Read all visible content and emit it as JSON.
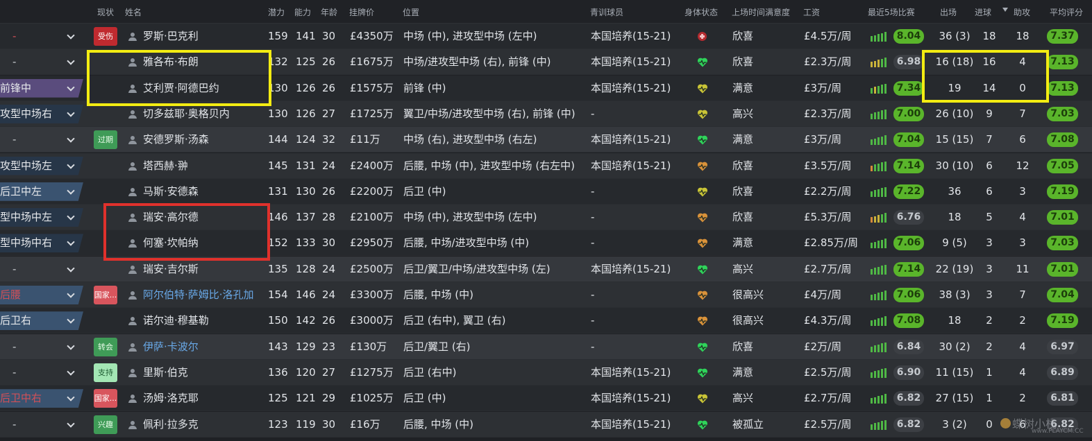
{
  "headers": {
    "status": "现状",
    "name": "姓名",
    "potential": "潜力",
    "ability": "能力",
    "age": "年龄",
    "price": "挂牌价",
    "position": "位置",
    "youth": "青训球员",
    "condition": "身体状态",
    "playtime": "上场时间满意度",
    "wage": "工资",
    "form": "最近5场比赛",
    "apps": "出场",
    "goals": "进球",
    "assists": "助攻",
    "avg": "平均评分"
  },
  "colors": {
    "heart_green": "#2fd35a",
    "heart_yellow": "#c9c437",
    "heart_orange": "#d9923a",
    "form_green": "#4fb845",
    "form_yellow": "#c9b33a",
    "form_orange": "#d68a3a",
    "highlight_yellow": "#f3ec12",
    "highlight_red": "#e0312c"
  },
  "players": [
    {
      "pos_role": "-",
      "pos_style": "plain",
      "pos_red": true,
      "badge": "受伤",
      "badge_style": "red",
      "name": "罗斯·巴克利",
      "link": false,
      "pot": "159",
      "abi": "141",
      "age": "30",
      "price": "£4350万",
      "position": "中场 (中), 进攻型中场 (左中)",
      "youth": "本国培养(15-21)",
      "cond": "injury-icon",
      "play": "欣喜",
      "wage": "£4.5万/周",
      "form": [
        "g",
        "g",
        "g",
        "g",
        "g"
      ],
      "r5": "8.04",
      "r5_style": "green",
      "apps": "36 (3)",
      "goals": "18",
      "assists": "18",
      "avg": "7.37",
      "avg_style": "green",
      "row": "even"
    },
    {
      "pos_role": "-",
      "pos_style": "plain",
      "pos_red": false,
      "badge": "",
      "badge_style": "",
      "name": "雅各布·布朗",
      "link": false,
      "pot": "132",
      "abi": "125",
      "age": "26",
      "price": "£1675万",
      "position": "中场/进攻型中场 (右), 前锋 (中)",
      "youth": "本国培养(15-21)",
      "cond": "heart-green-icon",
      "play": "欣喜",
      "wage": "£2.3万/周",
      "form": [
        "y",
        "y",
        "y",
        "g",
        "g"
      ],
      "r5": "6.98",
      "r5_style": "gray",
      "apps": "16 (18)",
      "goals": "16",
      "assists": "4",
      "avg": "7.13",
      "avg_style": "green",
      "row": "odd"
    },
    {
      "pos_role": "前锋中",
      "pos_style": "purple",
      "pos_red": false,
      "badge": "",
      "badge_style": "",
      "name": "艾利贾·阿德巴约",
      "link": false,
      "pot": "130",
      "abi": "126",
      "age": "26",
      "price": "£1575万",
      "position": "前锋 (中)",
      "youth": "本国培养(15-21)",
      "cond": "heart-yellow-icon",
      "play": "满意",
      "wage": "£3万/周",
      "form": [
        "g",
        "y",
        "g",
        "g",
        "g"
      ],
      "r5": "7.34",
      "r5_style": "green",
      "apps": "19",
      "goals": "14",
      "assists": "0",
      "avg": "7.13",
      "avg_style": "green",
      "row": "even"
    },
    {
      "pos_role": "攻型中场右",
      "pos_style": "navy",
      "pos_red": false,
      "badge": "",
      "badge_style": "",
      "name": "切多兹耶·奥格贝内",
      "link": false,
      "pot": "130",
      "abi": "126",
      "age": "27",
      "price": "£1725万",
      "position": "翼卫/中场/进攻型中场 (右), 前锋 (中)",
      "youth": "-",
      "cond": "heart-yellow-icon",
      "play": "高兴",
      "wage": "£2.3万/周",
      "form": [
        "g",
        "g",
        "g",
        "g",
        "g"
      ],
      "r5": "7.00",
      "r5_style": "green",
      "apps": "26 (10)",
      "goals": "9",
      "assists": "7",
      "avg": "7.03",
      "avg_style": "green",
      "row": "odd"
    },
    {
      "pos_role": "-",
      "pos_style": "plain",
      "pos_red": false,
      "badge": "过期",
      "badge_style": "green",
      "name": "安德罗斯·汤森",
      "link": false,
      "pot": "144",
      "abi": "124",
      "age": "32",
      "price": "£11万",
      "position": "中场 (右), 进攻型中场 (右左)",
      "youth": "本国培养(15-21)",
      "cond": "heart-green-icon",
      "play": "满意",
      "wage": "£3万/周",
      "form": [
        "g",
        "g",
        "g",
        "g",
        "g"
      ],
      "r5": "7.04",
      "r5_style": "green",
      "apps": "15 (15)",
      "goals": "7",
      "assists": "6",
      "avg": "7.08",
      "avg_style": "green",
      "row": "hl"
    },
    {
      "pos_role": "攻型中场左",
      "pos_style": "navy",
      "pos_red": false,
      "badge": "",
      "badge_style": "",
      "name": "塔西赫·翀",
      "link": false,
      "pot": "145",
      "abi": "131",
      "age": "24",
      "price": "£2400万",
      "position": "后腰, 中场 (中), 进攻型中场 (右左中)",
      "youth": "本国培养(15-21)",
      "cond": "heart-orange-icon",
      "play": "欣喜",
      "wage": "£3.5万/周",
      "form": [
        "o",
        "g",
        "g",
        "g",
        "g"
      ],
      "r5": "7.14",
      "r5_style": "green",
      "apps": "30 (10)",
      "goals": "6",
      "assists": "12",
      "avg": "7.05",
      "avg_style": "green",
      "row": "odd"
    },
    {
      "pos_role": "后卫中左",
      "pos_style": "steel",
      "pos_red": false,
      "badge": "",
      "badge_style": "",
      "name": "马斯·安德森",
      "link": false,
      "pot": "131",
      "abi": "130",
      "age": "26",
      "price": "£2200万",
      "position": "后卫 (中)",
      "youth": "-",
      "cond": "heart-yellow-icon",
      "play": "欣喜",
      "wage": "£2.2万/周",
      "form": [
        "g",
        "g",
        "g",
        "g",
        "g"
      ],
      "r5": "7.22",
      "r5_style": "green",
      "apps": "36",
      "goals": "6",
      "assists": "3",
      "avg": "7.19",
      "avg_style": "green",
      "row": "even"
    },
    {
      "pos_role": "型中场中左",
      "pos_style": "navy",
      "pos_red": false,
      "badge": "",
      "badge_style": "",
      "name": "瑞安·高尔德",
      "link": false,
      "pot": "146",
      "abi": "137",
      "age": "28",
      "price": "£2100万",
      "position": "中场 (中), 进攻型中场 (左中)",
      "youth": "-",
      "cond": "heart-orange-icon",
      "play": "欣喜",
      "wage": "£5.3万/周",
      "form": [
        "o",
        "y",
        "y",
        "g",
        "g"
      ],
      "r5": "6.76",
      "r5_style": "gray",
      "apps": "18",
      "goals": "5",
      "assists": "4",
      "avg": "7.01",
      "avg_style": "green",
      "row": "odd"
    },
    {
      "pos_role": "型中场中右",
      "pos_style": "navy",
      "pos_red": false,
      "badge": "",
      "badge_style": "",
      "name": "何塞·坎帕纳",
      "link": false,
      "pot": "152",
      "abi": "133",
      "age": "30",
      "price": "£2950万",
      "position": "后腰, 中场/进攻型中场 (中)",
      "youth": "-",
      "cond": "heart-orange-icon",
      "play": "满意",
      "wage": "£2.85万/周",
      "form": [
        "g",
        "g",
        "g",
        "g",
        "g"
      ],
      "r5": "7.06",
      "r5_style": "green",
      "apps": "9 (5)",
      "goals": "3",
      "assists": "3",
      "avg": "7.03",
      "avg_style": "green",
      "row": "even"
    },
    {
      "pos_role": "-",
      "pos_style": "plain",
      "pos_red": false,
      "badge": "",
      "badge_style": "",
      "name": "瑞安·吉尔斯",
      "link": false,
      "pot": "135",
      "abi": "128",
      "age": "24",
      "price": "£2500万",
      "position": "后卫/翼卫/中场/进攻型中场 (左)",
      "youth": "本国培养(15-21)",
      "cond": "heart-green-icon",
      "play": "高兴",
      "wage": "£2.7万/周",
      "form": [
        "g",
        "g",
        "g",
        "g",
        "g"
      ],
      "r5": "7.14",
      "r5_style": "green",
      "apps": "22 (19)",
      "goals": "3",
      "assists": "11",
      "avg": "7.01",
      "avg_style": "green",
      "row": "hl"
    },
    {
      "pos_role": "后腰",
      "pos_style": "steel",
      "pos_red": true,
      "badge": "国家...",
      "badge_style": "pink",
      "name": "阿尔伯特·萨姆比·洛孔加",
      "link": true,
      "pot": "154",
      "abi": "146",
      "age": "24",
      "price": "£3300万",
      "position": "后腰, 中场 (中)",
      "youth": "-",
      "cond": "heart-orange-icon",
      "play": "很高兴",
      "wage": "£4万/周",
      "form": [
        "g",
        "g",
        "g",
        "g",
        "g"
      ],
      "r5": "7.06",
      "r5_style": "green",
      "apps": "38 (3)",
      "goals": "3",
      "assists": "7",
      "avg": "7.04",
      "avg_style": "green",
      "row": "odd"
    },
    {
      "pos_role": "后卫右",
      "pos_style": "steel",
      "pos_red": false,
      "badge": "",
      "badge_style": "",
      "name": "诺尔迪·穆基勒",
      "link": false,
      "pot": "150",
      "abi": "142",
      "age": "26",
      "price": "£3000万",
      "position": "后卫 (右中), 翼卫 (右)",
      "youth": "-",
      "cond": "heart-orange-icon",
      "play": "很高兴",
      "wage": "£4.3万/周",
      "form": [
        "g",
        "g",
        "g",
        "g",
        "g"
      ],
      "r5": "7.08",
      "r5_style": "green",
      "apps": "18",
      "goals": "2",
      "assists": "2",
      "avg": "7.19",
      "avg_style": "green",
      "row": "even"
    },
    {
      "pos_role": "-",
      "pos_style": "plain",
      "pos_red": false,
      "badge": "转会",
      "badge_style": "green",
      "name": "伊萨·卡波尔",
      "link": true,
      "pot": "143",
      "abi": "129",
      "age": "23",
      "price": "£130万",
      "position": "后卫/翼卫 (右)",
      "youth": "-",
      "cond": "heart-green-icon",
      "play": "欣喜",
      "wage": "£2万/周",
      "form": [
        "g",
        "g",
        "g",
        "g",
        "g"
      ],
      "r5": "6.84",
      "r5_style": "gray",
      "apps": "30 (2)",
      "goals": "2",
      "assists": "4",
      "avg": "6.97",
      "avg_style": "gray",
      "row": "hl"
    },
    {
      "pos_role": "-",
      "pos_style": "plain",
      "pos_red": false,
      "badge": "支持",
      "badge_style": "mint",
      "name": "里斯·伯克",
      "link": false,
      "pot": "136",
      "abi": "120",
      "age": "27",
      "price": "£1275万",
      "position": "后卫 (右中)",
      "youth": "本国培养(15-21)",
      "cond": "heart-green-icon",
      "play": "满意",
      "wage": "£2.5万/周",
      "form": [
        "g",
        "g",
        "g",
        "g",
        "g"
      ],
      "r5": "6.90",
      "r5_style": "gray",
      "apps": "11 (15)",
      "goals": "1",
      "assists": "4",
      "avg": "6.89",
      "avg_style": "gray",
      "row": "odd"
    },
    {
      "pos_role": "后卫中右",
      "pos_style": "steel",
      "pos_red": true,
      "badge": "国家...",
      "badge_style": "pink",
      "name": "汤姆·洛克耶",
      "link": false,
      "pot": "125",
      "abi": "121",
      "age": "29",
      "price": "£1025万",
      "position": "后卫 (中)",
      "youth": "本国培养(15-21)",
      "cond": "heart-yellow-icon",
      "play": "高兴",
      "wage": "£2.7万/周",
      "form": [
        "g",
        "g",
        "g",
        "g",
        "g"
      ],
      "r5": "6.82",
      "r5_style": "gray",
      "apps": "27 (15)",
      "goals": "1",
      "assists": "2",
      "avg": "6.81",
      "avg_style": "gray",
      "row": "even"
    },
    {
      "pos_role": "-",
      "pos_style": "plain",
      "pos_red": false,
      "badge": "兴趣",
      "badge_style": "green",
      "name": "佩利·拉多克",
      "link": false,
      "pot": "123",
      "abi": "119",
      "age": "30",
      "price": "£16万",
      "position": "后腰, 中场 (中)",
      "youth": "本国培养(15-21)",
      "cond": "heart-green-icon",
      "play": "被孤立",
      "wage": "£2.5万/周",
      "form": [
        "g",
        "g",
        "g",
        "g",
        "g"
      ],
      "r5": "6.82",
      "r5_style": "gray",
      "apps": "3 (2)",
      "goals": "0",
      "assists": "6",
      "avg": "6.82",
      "avg_style": "gray",
      "row": "odd"
    }
  ],
  "watermark": {
    "main": "蝶树小栈",
    "sub": "www.PLAYCM.CC"
  }
}
